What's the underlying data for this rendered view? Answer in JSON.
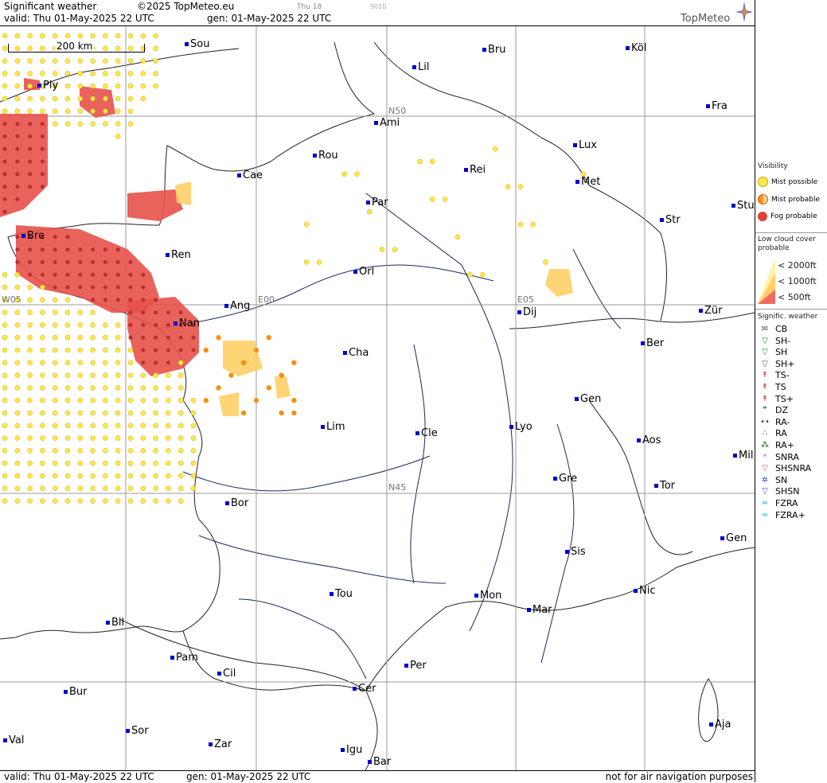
{
  "header": {
    "title": "Significant weather",
    "copyright": "©2025 TopMeteo.eu",
    "valid": "valid:  Thu  01-May-2025  22 UTC",
    "generated": "gen: 01-May-2025 22 UTC",
    "day_tag": "Thu 18",
    "code": "9010",
    "logo": "TopMeteo"
  },
  "footer": {
    "valid": "valid:  Thu  01-May-2025  22 UTC",
    "generated": "gen: 01-May-2025 22 UTC",
    "disclaimer": "not for air navigation purposes"
  },
  "scale_label": "200 km",
  "grid_labels": {
    "n50": "N50",
    "n45": "N45",
    "w05": "W05",
    "e00": "E00",
    "e05": "E05"
  },
  "cities": [
    {
      "name": "Sou"
    },
    {
      "name": "Bru"
    },
    {
      "name": "Köl"
    },
    {
      "name": "Ply"
    },
    {
      "name": "Lil"
    },
    {
      "name": "Ami"
    },
    {
      "name": "Fra"
    },
    {
      "name": "Lux"
    },
    {
      "name": "Rou"
    },
    {
      "name": "Cae"
    },
    {
      "name": "Rei"
    },
    {
      "name": "Met"
    },
    {
      "name": "Par"
    },
    {
      "name": "Stu"
    },
    {
      "name": "Str"
    },
    {
      "name": "Bre"
    },
    {
      "name": "Ren"
    },
    {
      "name": "Orl"
    },
    {
      "name": "Ang"
    },
    {
      "name": "Dij"
    },
    {
      "name": "Zür"
    },
    {
      "name": "Nan"
    },
    {
      "name": "Cha"
    },
    {
      "name": "Ber"
    },
    {
      "name": "Gen"
    },
    {
      "name": "Lim"
    },
    {
      "name": "Cle"
    },
    {
      "name": "Lyo"
    },
    {
      "name": "Aos"
    },
    {
      "name": "Mil"
    },
    {
      "name": "Gre"
    },
    {
      "name": "Tor"
    },
    {
      "name": "Bor"
    },
    {
      "name": "Gen"
    },
    {
      "name": "Sis"
    },
    {
      "name": "Nic"
    },
    {
      "name": "Tou"
    },
    {
      "name": "Mon"
    },
    {
      "name": "Mar"
    },
    {
      "name": "Bil"
    },
    {
      "name": "Pam"
    },
    {
      "name": "Cil"
    },
    {
      "name": "Per"
    },
    {
      "name": "Cer"
    },
    {
      "name": "Bur"
    },
    {
      "name": "Sor"
    },
    {
      "name": "Aja"
    },
    {
      "name": "Val"
    },
    {
      "name": "Zar"
    },
    {
      "name": "Igu"
    },
    {
      "name": "Bar"
    }
  ],
  "legend": {
    "visibility_title": "Visibility",
    "mist_possible": "Mist possible",
    "mist_probable": "Mist probable",
    "fog_probable": "Fog probable",
    "low_cloud_title": "Low cloud cover probable",
    "c2000": "< 2000ft",
    "c1000": "< 1000ft",
    "c500": "<  500ft",
    "signif_title": "Signific. weather",
    "items": [
      "CB",
      "SH-",
      "SH",
      "SH+",
      "TS-",
      "TS",
      "TS+",
      "DZ",
      "RA-",
      "RA",
      "RA+",
      "SNRA",
      "SHSNRA",
      "SN",
      "SHSN",
      "FZRA",
      "FZRA+"
    ]
  },
  "colors": {
    "mist_possible": "#ffe84a",
    "mist_probable": "#ff8c1a",
    "fog_probable": "#e0403a",
    "cloud_2000": "#fff2a8",
    "cloud_1000": "#ffcf66",
    "cloud_500": "#f06a60",
    "city_dot": "#0000cc"
  }
}
